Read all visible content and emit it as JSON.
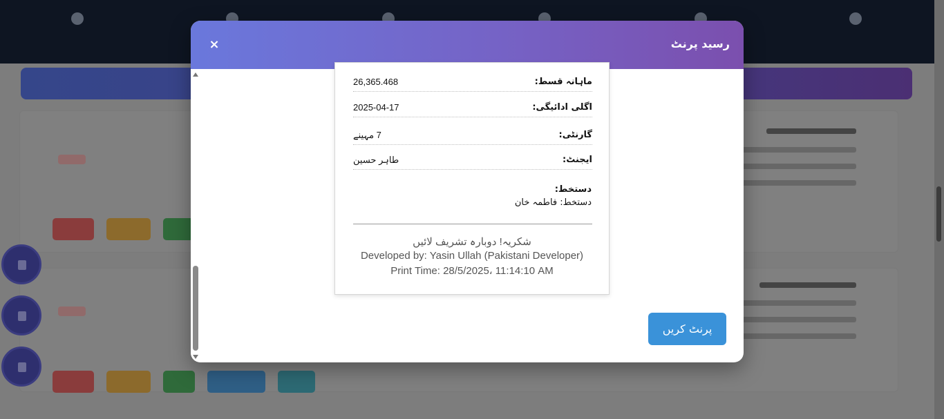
{
  "modal": {
    "title": "رسید پرنٹ",
    "close_icon": "×",
    "print_button": "پرنٹ کریں"
  },
  "receipt": {
    "rows": [
      {
        "label": "ماہانہ قسط:",
        "value": "26,365.468"
      },
      {
        "label": "اگلی ادائیگی:",
        "value": "2025-04-17"
      },
      {
        "label": "گارنٹی:",
        "value": "7 مہینے"
      },
      {
        "label": "ایجنٹ:",
        "value": "طاہر حسین"
      }
    ],
    "signature_label": "دستخط:",
    "signature_value": "دستخط: فاطمہ خان",
    "footer": {
      "thanks": "شکریہ! دوبارہ تشریف لائیں",
      "developer": "Developed by: Yasin Ullah (Pakistani Developer)",
      "print_time": "Print Time: 28/5/2025، 11:14:10 AM"
    }
  },
  "colors": {
    "header_gradient_start": "#6a78dc",
    "header_gradient_end": "#7b4fae",
    "print_button": "#3a92d9",
    "overlay": "#7d7d7d"
  }
}
